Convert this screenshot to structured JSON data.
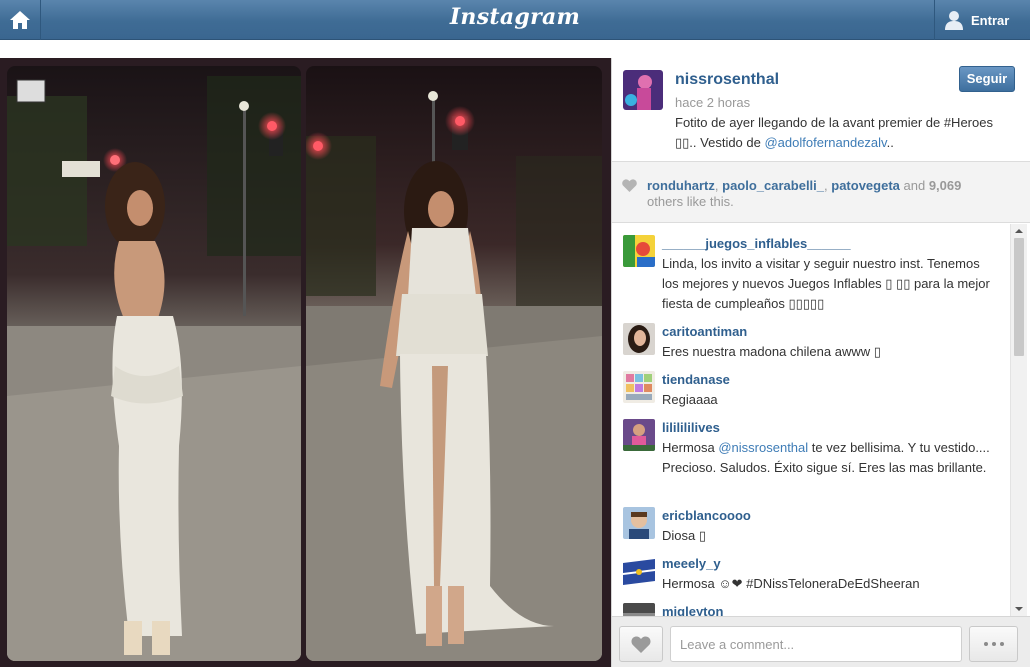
{
  "topbar": {
    "logo": "Instagram",
    "login_label": "Entrar"
  },
  "post": {
    "author": "nissrosenthal",
    "time": "hace 2 horas",
    "follow_label": "Seguir",
    "caption_text": "Fotito de ayer llegando de la avant premier de #Heroes ▯▯.. Vestido de ",
    "caption_mention": "@adolfofernandezalv",
    "caption_tail": ".."
  },
  "likes": {
    "users": [
      "ronduhartz",
      "paolo_carabelli_",
      "patovegeta"
    ],
    "sep1": ", ",
    "sep2": ", ",
    "and_label": " and ",
    "count": "9,069",
    "others_label": "others like this."
  },
  "comments": [
    {
      "user": "______juegos_inflables______",
      "text": "Linda, los invito a visitar y seguir nuestro inst. Tenemos los mejores y nuevos Juegos Inflables ▯ ▯▯ para la mejor fiesta de cumpleaños ▯▯▯▯▯"
    },
    {
      "user": "caritoantiman",
      "text": "Eres nuestra madona chilena awww ▯"
    },
    {
      "user": "tiendanase",
      "text": "Regiaaaa"
    },
    {
      "user": "lililililives",
      "text_before": "Hermosa ",
      "mention": "@nissrosenthal",
      "text_after": " te vez bellisima. Y tu vestido.... Precioso. Saludos. Éxito sigue sí. Eres las mas brillante."
    },
    {
      "user": "ericblancoooo",
      "text": "Diosa ▯"
    },
    {
      "user": "meeely_y",
      "text": "Hermosa ☺❤ #DNissTeloneraDeEdSheeran"
    },
    {
      "user": "migleyton",
      "text": ""
    }
  ],
  "footer": {
    "comment_placeholder": "Leave a comment..."
  },
  "icons": {
    "home": "home-icon",
    "user": "user-icon",
    "heart": "heart-icon",
    "more": "more-icon"
  }
}
